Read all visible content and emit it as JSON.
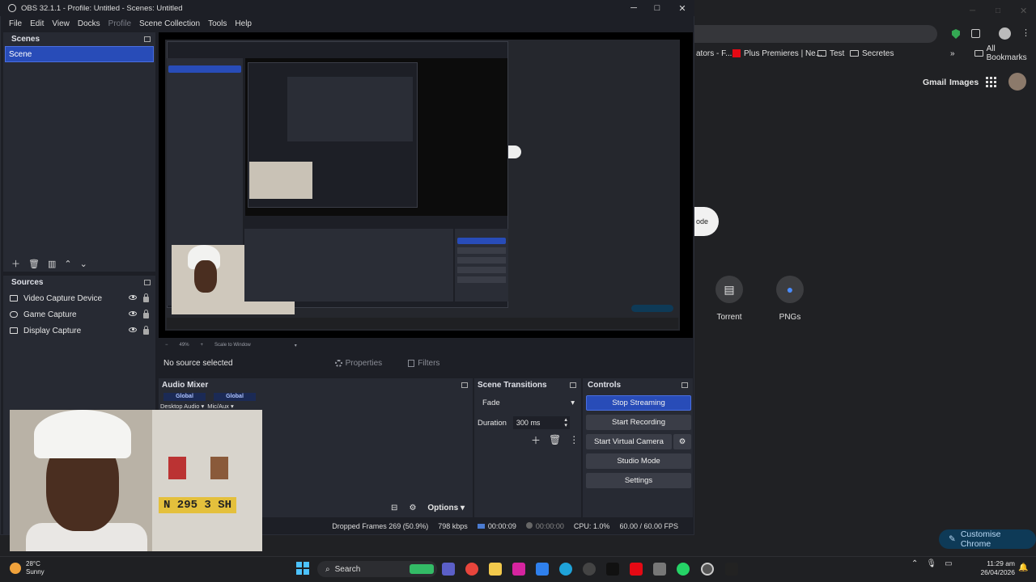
{
  "obs": {
    "title": "OBS 32.1.1 - Profile: Untitled - Scenes: Untitled",
    "menu": [
      "File",
      "Edit",
      "View",
      "Docks",
      "Profile",
      "Scene Collection",
      "Tools",
      "Help"
    ],
    "scenes": {
      "header": "Scenes",
      "items": [
        "Scene"
      ]
    },
    "sources": {
      "header": "Sources",
      "items": [
        "Video Capture Device",
        "Game Capture",
        "Display Capture"
      ]
    },
    "preview": {
      "zoom": "49%",
      "scale_mode": "Scale to Window"
    },
    "context": {
      "no_source": "No source selected",
      "properties": "Properties",
      "filters": "Filters"
    },
    "audio_mixer": {
      "header": "Audio Mixer",
      "tabs": [
        "Global",
        "Global"
      ],
      "channels": [
        "Desktop Audio",
        "Mic/Aux"
      ],
      "options": "Options"
    },
    "scene_transitions": {
      "header": "Scene Transitions",
      "transition": "Fade",
      "duration_label": "Duration",
      "duration_value": "300 ms"
    },
    "controls": {
      "header": "Controls",
      "stop_streaming": "Stop Streaming",
      "start_recording": "Start Recording",
      "start_virtual_camera": "Start Virtual Camera",
      "studio_mode": "Studio Mode",
      "settings": "Settings"
    },
    "status": {
      "dropped_frames": "Dropped Frames 269 (50.9%)",
      "bitrate": "798 kbps",
      "stream_time": "00:00:09",
      "rec_time": "00:00:00",
      "cpu": "CPU: 1.0%",
      "fps": "60.00 / 60.00 FPS"
    },
    "webcam_plate": "N 295 3 SH"
  },
  "chrome": {
    "bookmarks": [
      "ators - F...",
      "Plus Premieres | Ne...",
      "Test",
      "Secretes"
    ],
    "all_bookmarks": "All Bookmarks",
    "gmail": "Gmail",
    "images": "Images",
    "shortcuts": [
      "Torrent",
      "PNGs"
    ],
    "partial_button": "ode",
    "customise": "Customise Chrome"
  },
  "taskbar": {
    "temperature": "28°C",
    "weather": "Sunny",
    "search": "Search",
    "time": "11:29 am",
    "date": "26/04/2026"
  }
}
